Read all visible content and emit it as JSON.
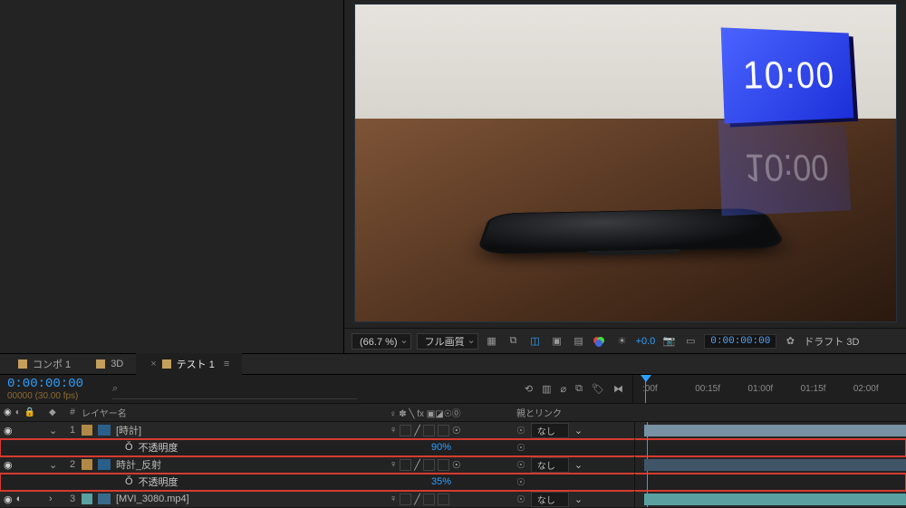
{
  "viewer": {
    "clock_text": "10:00",
    "zoom": "(66.7 %)",
    "quality": "フル画質",
    "exposure": "+0.0",
    "timecode": "0:00:00:00",
    "draft3d": "ドラフト 3D"
  },
  "tabs": [
    {
      "label": "コンポ 1",
      "active": false
    },
    {
      "label": "3D",
      "active": false
    },
    {
      "label": "テスト 1",
      "active": true
    }
  ],
  "timeline": {
    "current_time": "0:00:00:00",
    "frame_fps": "00000 (30.00 fps)",
    "ruler": [
      ":00f",
      "00:15f",
      "01:00f",
      "01:15f",
      "02:00f"
    ],
    "column_layer_name": "レイヤー名",
    "column_parent": "親とリンク",
    "switch_header": "♀ ✽ ╲ fx"
  },
  "layers": [
    {
      "num": 1,
      "name": "[時計]",
      "parent": "なし"
    },
    {
      "num": 2,
      "name": "時計_反射",
      "parent": "なし"
    },
    {
      "num": 3,
      "name": "[MVI_3080.mp4]",
      "parent": "なし"
    }
  ],
  "props": {
    "opacity_label": "不透明度",
    "layer1_opacity": "90%",
    "layer2_opacity": "35%"
  }
}
